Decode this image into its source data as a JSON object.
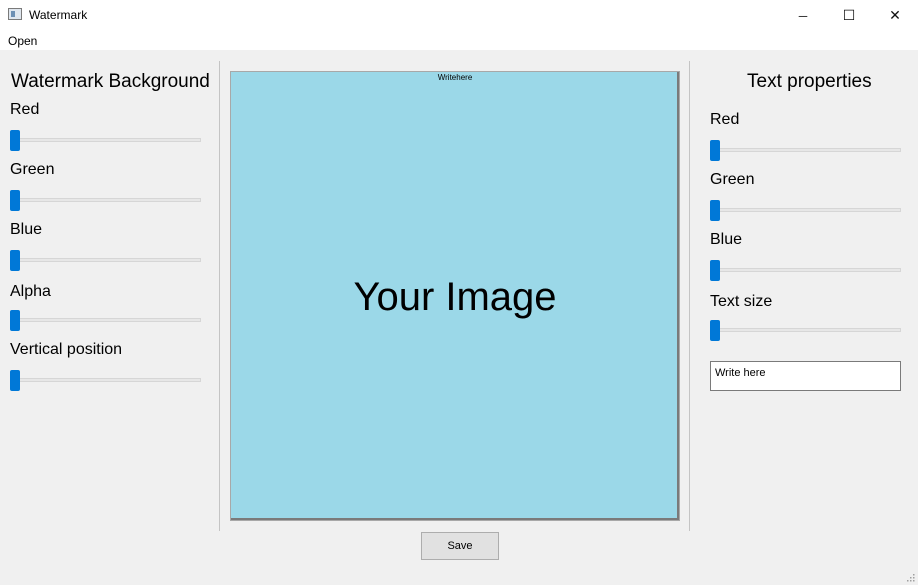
{
  "window": {
    "title": "Watermark",
    "icon": "app-window-icon"
  },
  "window_controls": {
    "minimize": "─",
    "maximize": "☐",
    "close": "✕"
  },
  "menu": {
    "open": "Open"
  },
  "left_panel": {
    "title": "Watermark Background",
    "sliders": [
      {
        "label": "Red",
        "value": 0
      },
      {
        "label": "Green",
        "value": 0
      },
      {
        "label": "Blue",
        "value": 0
      },
      {
        "label": "Alpha",
        "value": 0
      },
      {
        "label": "Vertical position",
        "value": 0
      }
    ]
  },
  "preview": {
    "caption": "Writehere",
    "placeholder": "Your Image",
    "background_color": "#9bd8e8"
  },
  "right_panel": {
    "title": "Text properties",
    "sliders": [
      {
        "label": "Red",
        "value": 0
      },
      {
        "label": "Green",
        "value": 0
      },
      {
        "label": "Blue",
        "value": 0
      },
      {
        "label": "Text size",
        "value": 0
      }
    ],
    "text_input": {
      "value": "Write here"
    }
  },
  "save_button": {
    "label": "Save"
  },
  "colors": {
    "accent": "#0078d7",
    "background": "#f0f0f0"
  }
}
